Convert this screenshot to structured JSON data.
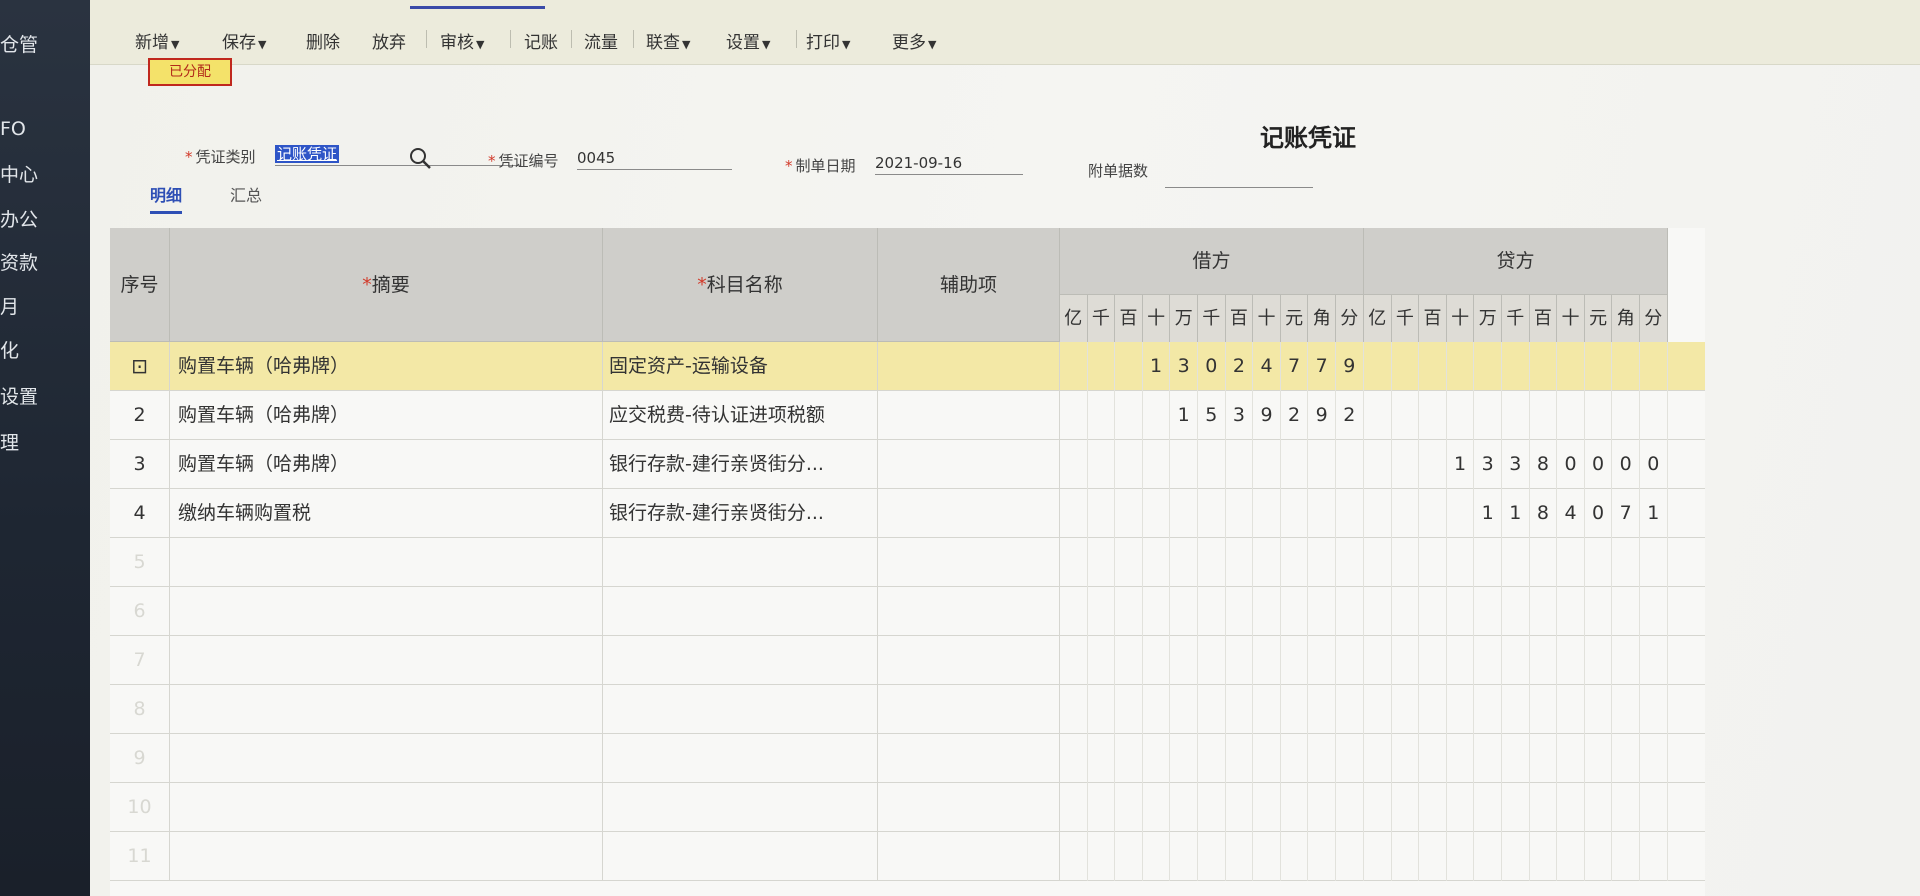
{
  "sidebar": {
    "items": [
      "仓管",
      "FO",
      "中心",
      "办公",
      "资款",
      "月",
      "化",
      "设置",
      "理"
    ]
  },
  "toolbar": {
    "buttons": [
      {
        "label": "新增",
        "caret": true
      },
      {
        "label": "保存",
        "caret": true
      },
      {
        "label": "删除",
        "caret": false
      },
      {
        "label": "放弃",
        "caret": false
      },
      {
        "label": "审核",
        "caret": true
      },
      {
        "label": "记账",
        "caret": false
      },
      {
        "label": "流量",
        "caret": false
      },
      {
        "label": "联查",
        "caret": true
      },
      {
        "label": "设置",
        "caret": true
      },
      {
        "label": "打印",
        "caret": true
      },
      {
        "label": "更多",
        "caret": true
      }
    ]
  },
  "status_badge": "已分配",
  "voucher": {
    "title": "记账凭证",
    "type_label": "凭证类别",
    "type_value": "记账凭证",
    "number_label": "凭证编号",
    "number_value": "0045",
    "date_label": "制单日期",
    "date_value": "2021-09-16",
    "attachments_label": "附单据数",
    "attachments_value": ""
  },
  "subtabs": {
    "detail": "明细",
    "summary": "汇总"
  },
  "grid": {
    "headers": {
      "seq": "序号",
      "summary": "摘要",
      "account": "科目名称",
      "aux": "辅助项",
      "debit": "借方",
      "credit": "贷方"
    },
    "digit_units": [
      "亿",
      "千",
      "百",
      "十",
      "万",
      "千",
      "百",
      "十",
      "元",
      "角",
      "分"
    ],
    "rows": [
      {
        "seq": "",
        "summary": "购置车辆（哈弗牌）",
        "account": "固定资产-运输设备",
        "debit": "130247.79",
        "credit": ""
      },
      {
        "seq": "2",
        "summary": "购置车辆（哈弗牌）",
        "account": "应交税费-待认证进项税额",
        "debit": "15392.92",
        "credit": ""
      },
      {
        "seq": "3",
        "summary": "购置车辆（哈弗牌）",
        "account": "银行存款-建行亲贤街分...",
        "debit": "",
        "credit": "133800.00"
      },
      {
        "seq": "4",
        "summary": "缴纳车辆购置税",
        "account": "银行存款-建行亲贤街分...",
        "debit": "",
        "credit": "11840.71"
      },
      {
        "seq": "5",
        "summary": "",
        "account": "",
        "debit": "",
        "credit": ""
      },
      {
        "seq": "6",
        "summary": "",
        "account": "",
        "debit": "",
        "credit": ""
      },
      {
        "seq": "7",
        "summary": "",
        "account": "",
        "debit": "",
        "credit": ""
      },
      {
        "seq": "8",
        "summary": "",
        "account": "",
        "debit": "",
        "credit": ""
      },
      {
        "seq": "9",
        "summary": "",
        "account": "",
        "debit": "",
        "credit": ""
      },
      {
        "seq": "10",
        "summary": "",
        "account": "",
        "debit": "",
        "credit": ""
      },
      {
        "seq": "11",
        "summary": "",
        "account": "",
        "debit": "",
        "credit": ""
      }
    ]
  }
}
